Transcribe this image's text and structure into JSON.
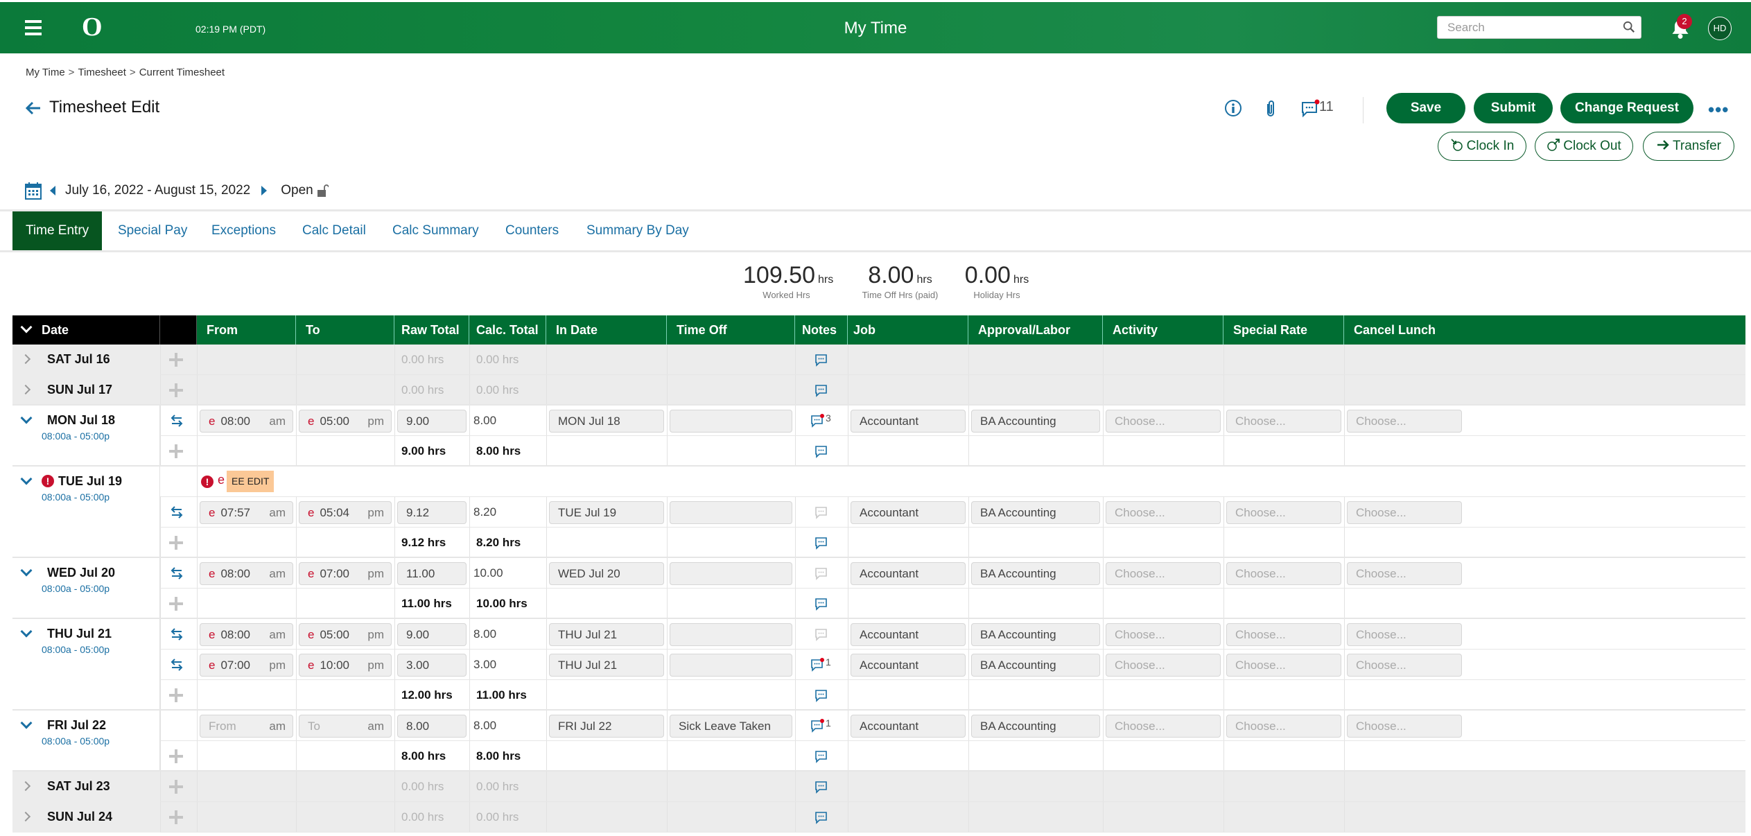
{
  "header": {
    "time": "02:19 PM (PDT)",
    "app_title": "My Time",
    "search_placeholder": "Search",
    "notifications_count": "2",
    "avatar_initials": "HD",
    "logo": "O"
  },
  "breadcrumb": [
    "My Time",
    "Timesheet",
    "Current Timesheet"
  ],
  "page_title": "Timesheet Edit",
  "toolbar": {
    "comments_count": "11",
    "save_label": "Save",
    "submit_label": "Submit",
    "change_request_label": "Change Request",
    "more_label": "•••",
    "clock_in_label": "Clock In",
    "clock_out_label": "Clock Out",
    "transfer_label": "Transfer"
  },
  "period": {
    "range": "July 16, 2022 - August 15, 2022",
    "status": "Open"
  },
  "tabs": [
    {
      "label": "Time Entry",
      "active": true
    },
    {
      "label": "Special Pay",
      "active": false
    },
    {
      "label": "Exceptions",
      "active": false
    },
    {
      "label": "Calc Detail",
      "active": false
    },
    {
      "label": "Calc Summary",
      "active": false
    },
    {
      "label": "Counters",
      "active": false
    },
    {
      "label": "Summary By Day",
      "active": false
    }
  ],
  "summary": [
    {
      "value": "109.50",
      "unit": "hrs",
      "label": "Worked Hrs"
    },
    {
      "value": "8.00",
      "unit": "hrs",
      "label": "Time Off Hrs (paid)"
    },
    {
      "value": "0.00",
      "unit": "hrs",
      "label": "Holiday Hrs"
    }
  ],
  "columns": [
    "Date",
    "",
    "From",
    "To",
    "Raw Total",
    "Calc. Total",
    "In Date",
    "Time Off",
    "Notes",
    "Job",
    "Approval/Labor",
    "Activity",
    "Special Rate",
    "Cancel Lunch"
  ],
  "placeholders": {
    "choose": "Choose...",
    "from": "From",
    "to": "To"
  },
  "days": [
    {
      "label": "SAT Jul 16",
      "expanded": false,
      "raw_total": "0.00 hrs",
      "calc_total": "0.00 hrs"
    },
    {
      "label": "SUN Jul 17",
      "expanded": false,
      "raw_total": "0.00 hrs",
      "calc_total": "0.00 hrs"
    },
    {
      "label": "MON Jul 18",
      "expanded": true,
      "schedule": "08:00a - 05:00p",
      "entries": [
        {
          "from": "08:00",
          "from_ampm": "am",
          "to": "05:00",
          "to_ampm": "pm",
          "raw": "9.00",
          "calc": "8.00",
          "in_date": "MON Jul 18",
          "time_off": "",
          "notes_count": "3",
          "job": "Accountant",
          "approval": "BA Accounting"
        }
      ],
      "raw_total": "9.00 hrs",
      "calc_total": "8.00 hrs"
    },
    {
      "label": "TUE Jul 19",
      "expanded": true,
      "error": true,
      "schedule": "08:00a - 05:00p",
      "exception_badge": "EE EDIT",
      "entries": [
        {
          "from": "07:57",
          "from_ampm": "am",
          "to": "05:04",
          "to_ampm": "pm",
          "raw": "9.12",
          "calc": "8.20",
          "in_date": "TUE Jul 19",
          "time_off": "",
          "notes_count": "",
          "job": "Accountant",
          "approval": "BA Accounting"
        }
      ],
      "raw_total": "9.12 hrs",
      "calc_total": "8.20 hrs"
    },
    {
      "label": "WED Jul 20",
      "expanded": true,
      "schedule": "08:00a - 05:00p",
      "entries": [
        {
          "from": "08:00",
          "from_ampm": "am",
          "to": "07:00",
          "to_ampm": "pm",
          "raw": "11.00",
          "calc": "10.00",
          "in_date": "WED Jul 20",
          "time_off": "",
          "notes_count": "",
          "job": "Accountant",
          "approval": "BA Accounting"
        }
      ],
      "raw_total": "11.00 hrs",
      "calc_total": "10.00 hrs"
    },
    {
      "label": "THU Jul 21",
      "expanded": true,
      "schedule": "08:00a - 05:00p",
      "entries": [
        {
          "from": "08:00",
          "from_ampm": "am",
          "to": "05:00",
          "to_ampm": "pm",
          "raw": "9.00",
          "calc": "8.00",
          "in_date": "THU Jul 21",
          "time_off": "",
          "notes_count": "",
          "job": "Accountant",
          "approval": "BA Accounting"
        },
        {
          "from": "07:00",
          "from_ampm": "pm",
          "to": "10:00",
          "to_ampm": "pm",
          "raw": "3.00",
          "calc": "3.00",
          "in_date": "THU Jul 21",
          "time_off": "",
          "notes_count": "1",
          "job": "Accountant",
          "approval": "BA Accounting"
        }
      ],
      "raw_total": "12.00 hrs",
      "calc_total": "11.00 hrs"
    },
    {
      "label": "FRI Jul 22",
      "expanded": true,
      "schedule": "08:00a - 05:00p",
      "entries": [
        {
          "from": "",
          "from_ampm": "am",
          "to": "",
          "to_ampm": "am",
          "raw": "8.00",
          "calc": "8.00",
          "in_date": "FRI Jul 22",
          "time_off": "Sick Leave Taken",
          "notes_count": "1",
          "job": "Accountant",
          "approval": "BA Accounting",
          "no_punch": true
        }
      ],
      "raw_total": "8.00 hrs",
      "calc_total": "8.00 hrs"
    },
    {
      "label": "SAT Jul 23",
      "expanded": false,
      "raw_total": "0.00 hrs",
      "calc_total": "0.00 hrs"
    },
    {
      "label": "SUN Jul 24",
      "expanded": false,
      "raw_total": "0.00 hrs",
      "calc_total": "0.00 hrs"
    }
  ],
  "colors": {
    "brand_green": "#006e33",
    "link_blue": "#1a6fa3",
    "error_red": "#c8102e",
    "badge_orange": "#fbc896"
  }
}
